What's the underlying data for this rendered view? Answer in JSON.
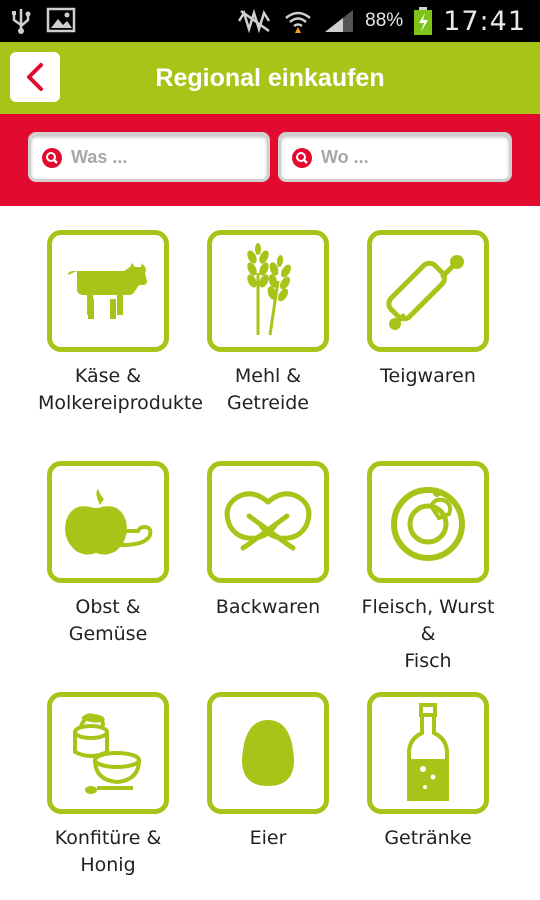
{
  "status_bar": {
    "battery_percent": "88%",
    "time": "17:41",
    "icons": [
      "usb-icon",
      "image-icon",
      "muted-icon",
      "wifi-icon",
      "signal-icon",
      "battery-charging-icon"
    ]
  },
  "header": {
    "title": "Regional einkaufen",
    "back_icon": "chevron-left-icon"
  },
  "search": {
    "what_placeholder": "Was ...",
    "where_placeholder": "Wo ..."
  },
  "colors": {
    "accent_green": "#a8c418",
    "brand_red": "#e30a2f"
  },
  "categories": [
    {
      "label": "Käse &\nMolkereiprodukte",
      "icon": "cow-icon"
    },
    {
      "label": "Mehl & Getreide",
      "icon": "wheat-icon"
    },
    {
      "label": "Teigwaren",
      "icon": "rolling-pin-icon"
    },
    {
      "label": "Obst & Gemüse",
      "icon": "apple-icon"
    },
    {
      "label": "Backwaren",
      "icon": "pretzel-icon"
    },
    {
      "label": "Fleisch, Wurst &\nFisch",
      "icon": "sausage-icon"
    },
    {
      "label": "Konfitüre &\nHonig",
      "icon": "jam-bowl-icon"
    },
    {
      "label": "Eier",
      "icon": "egg-icon"
    },
    {
      "label": "Getränke",
      "icon": "bottle-icon"
    }
  ]
}
